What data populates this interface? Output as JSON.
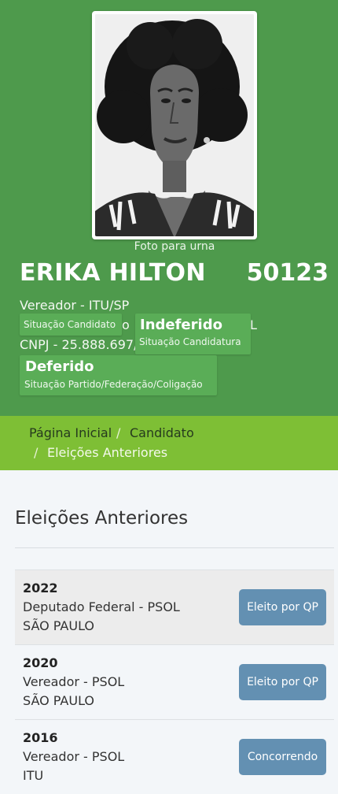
{
  "photo": {
    "caption": "Foto para urna"
  },
  "candidate": {
    "name": "ERIKA HILTON",
    "number": "50123",
    "office_line": "Vereador - ITU/SP",
    "party_line_tail": "o",
    "party_line_end": "L",
    "cnpj_line": "CNPJ - 25.888.697/"
  },
  "badges": {
    "situacao_candidato_label": "Situação Candidato",
    "candidatura_value": "Indeferido",
    "candidatura_label": "Situação Candidatura",
    "partido_value": "Deferido",
    "partido_label": "Situação Partido/Federação/Coligação"
  },
  "breadcrumb": {
    "home": "Página Inicial",
    "candidate": "Candidato",
    "current": "Eleições Anteriores",
    "separator": "/"
  },
  "section": {
    "title": "Eleições Anteriores"
  },
  "elections": [
    {
      "year": "2022",
      "role": "Deputado Federal - PSOL",
      "place": "SÃO PAULO",
      "status": "Eleito por QP"
    },
    {
      "year": "2020",
      "role": "Vereador - PSOL",
      "place": "SÃO PAULO",
      "status": "Eleito por QP"
    },
    {
      "year": "2016",
      "role": "Vereador - PSOL",
      "place": "ITU",
      "status": "Concorrendo"
    }
  ],
  "colors": {
    "header_green": "#4e9a4c",
    "badge_green": "#5aad57",
    "breadcrumb_green": "#7ebf35",
    "status_button": "#6390b2"
  }
}
